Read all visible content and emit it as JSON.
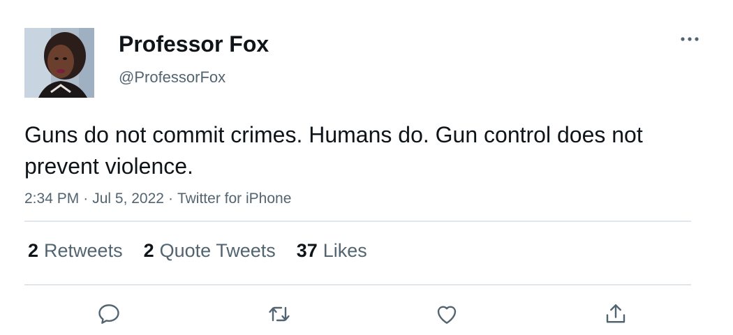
{
  "author": {
    "display_name": "Professor Fox",
    "handle": "@ProfessorFox",
    "avatar_icon": "profile-photo"
  },
  "tweet": {
    "text": "Guns do not commit crimes. Humans do. Gun control does not prevent violence.",
    "time": "2:34 PM",
    "date": "Jul 5, 2022",
    "source": "Twitter for iPhone",
    "separator": "·"
  },
  "stats": {
    "retweets_count": "2",
    "retweets_label": "Retweets",
    "quote_count": "2",
    "quote_label": "Quote Tweets",
    "likes_count": "37",
    "likes_label": "Likes"
  },
  "actions": {
    "icons": [
      "reply-icon",
      "retweet-icon",
      "like-icon",
      "share-icon"
    ],
    "more_icon": "more-options-icon"
  },
  "colors": {
    "primary_text": "#0f1419",
    "secondary_text": "#536471",
    "divider": "#e1e6ea"
  }
}
